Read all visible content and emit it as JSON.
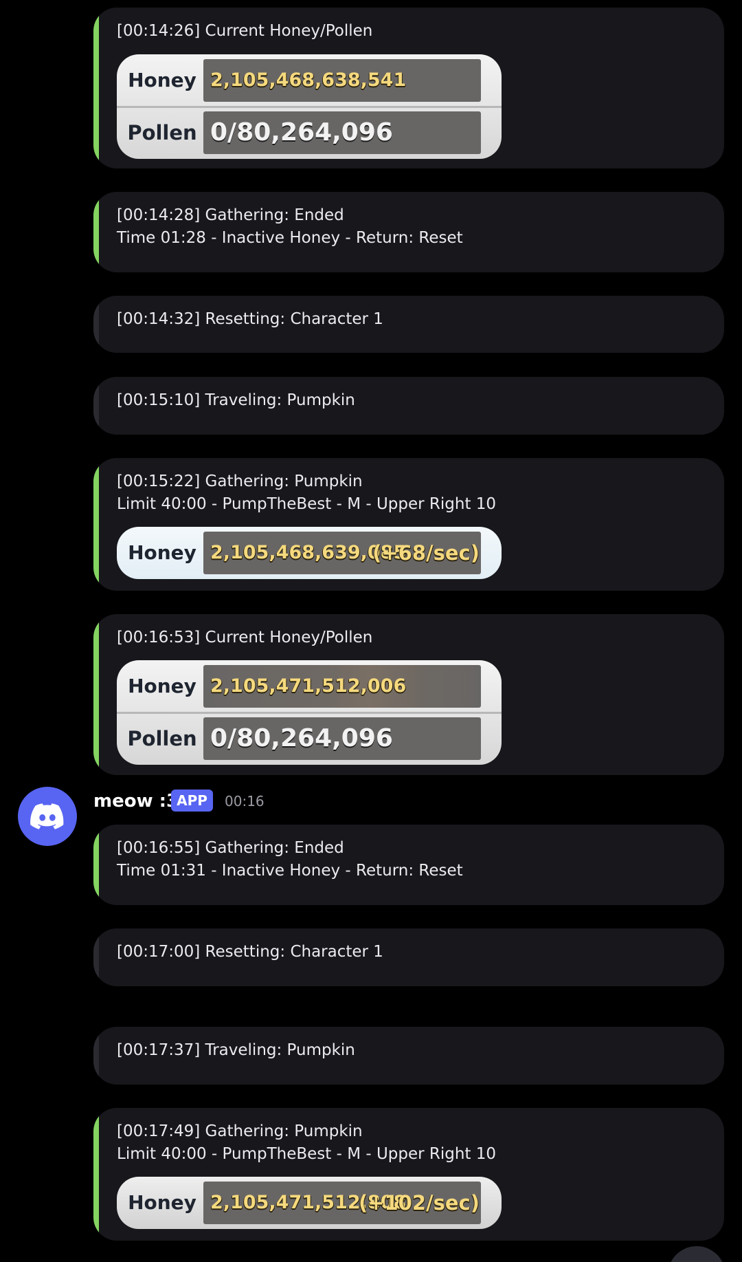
{
  "colors": {
    "background": "#000000",
    "embed_background": "#17171c",
    "accent_green": "#84d461",
    "accent_dark": "#2a2a30",
    "blurple": "#5865f2",
    "honey_gold": "#f5d97e"
  },
  "messages": [
    {
      "accent": "green",
      "lines": [
        "[00:14:26] Current Honey/Pollen"
      ],
      "stats": {
        "honey_label": "Honey",
        "honey_value": "2,105,468,638,541",
        "pollen_label": "Pollen",
        "pollen_value": "0/80,264,096"
      }
    },
    {
      "accent": "green",
      "lines": [
        "[00:14:28] Gathering: Ended",
        "Time 01:28 - Inactive Honey - Return: Reset"
      ]
    },
    {
      "accent": "dark",
      "lines": [
        "[00:14:32] Resetting: Character 1"
      ]
    },
    {
      "accent": "dark",
      "lines": [
        "[00:15:10] Traveling: Pumpkin"
      ]
    },
    {
      "accent": "green",
      "lines": [
        "[00:15:22] Gathering: Pumpkin",
        "Limit 40:00 - PumpTheBest - M - Upper Right 10"
      ],
      "stats": {
        "honey_label": "Honey",
        "honey_value": "2,105,468,639,085",
        "rate": "(+68/sec)"
      }
    },
    {
      "accent": "green",
      "lines": [
        "[00:16:53] Current Honey/Pollen"
      ],
      "stats": {
        "honey_label": "Honey",
        "honey_value": "2,105,471,512,006",
        "pollen_label": "Pollen",
        "pollen_value": "0/80,264,096"
      }
    },
    {
      "accent": "green",
      "lines": [
        "[00:16:55] Gathering: Ended",
        "Time 01:31 - Inactive Honey - Return: Reset"
      ]
    },
    {
      "accent": "dark",
      "lines": [
        "[00:17:00] Resetting: Character 1"
      ]
    },
    {
      "accent": "dark",
      "lines": [
        "[00:17:37] Traveling: Pumpkin"
      ]
    },
    {
      "accent": "green",
      "lines": [
        "[00:17:49] Gathering: Pumpkin",
        "Limit 40:00 - PumpTheBest - M - Upper Right 10"
      ],
      "stats": {
        "honey_label": "Honey",
        "honey_value": "2,105,471,512,808",
        "rate": "(+102/sec)"
      }
    }
  ],
  "author": {
    "name": "meow :3",
    "badge": "APP",
    "time": "00:16",
    "avatar_icon": "discord-logo-icon"
  },
  "fab_icon": "circle-button-icon"
}
